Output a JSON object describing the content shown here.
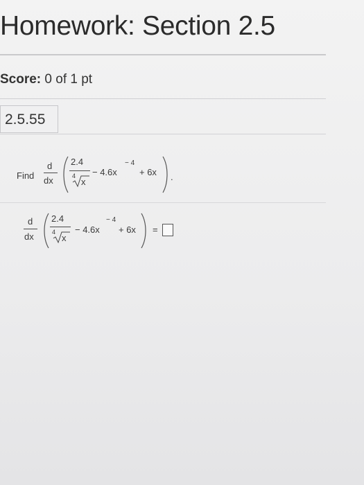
{
  "header": {
    "title": "Homework: Section 2.5"
  },
  "score": {
    "label": "Score:",
    "value": "0 of 1 pt"
  },
  "question": {
    "number": "2.5.55",
    "prompt_word": "Find",
    "expression": {
      "d": "d",
      "dx": "dx",
      "numerator": "2.4",
      "root_index": "4",
      "radicand": "x",
      "term2": "− 4.6x",
      "exponent": "− 4",
      "term3": "+ 6x",
      "end_punct": "."
    },
    "answer": {
      "equals": "=",
      "value": ""
    }
  }
}
